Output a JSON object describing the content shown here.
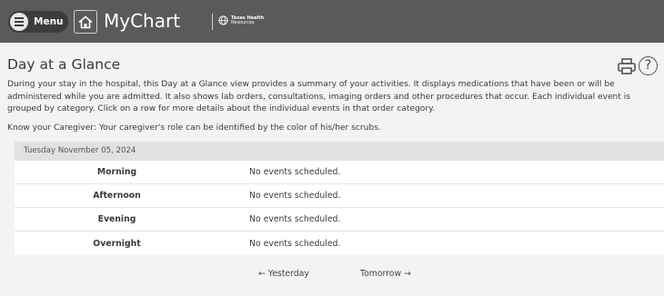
{
  "header": {
    "menu_label": "Menu",
    "app_title": "MyChart",
    "brand_line1": "Texas Health",
    "brand_line2": "Resources"
  },
  "page": {
    "title": "Day at a Glance",
    "intro": "During your stay in the hospital, this Day at a Glance view provides a summary of your activities. It displays medications that have been or will be administered while you are admitted. It also shows lab orders, consultations, imaging orders and other procedures that occur. Each individual event is grouped by category. Click on a row for more details about the individual events in that order category.",
    "caregiver_note": "Know your Caregiver: Your caregiver's role can be identified by the color of his/her scrubs."
  },
  "schedule": {
    "date": "Tuesday November 05, 2024",
    "rows": [
      {
        "period": "Morning",
        "status": "No events scheduled."
      },
      {
        "period": "Afternoon",
        "status": "No events scheduled."
      },
      {
        "period": "Evening",
        "status": "No events scheduled."
      },
      {
        "period": "Overnight",
        "status": "No events scheduled."
      }
    ]
  },
  "pager": {
    "prev_label": "← Yesterday",
    "next_label": "Tomorrow →"
  }
}
